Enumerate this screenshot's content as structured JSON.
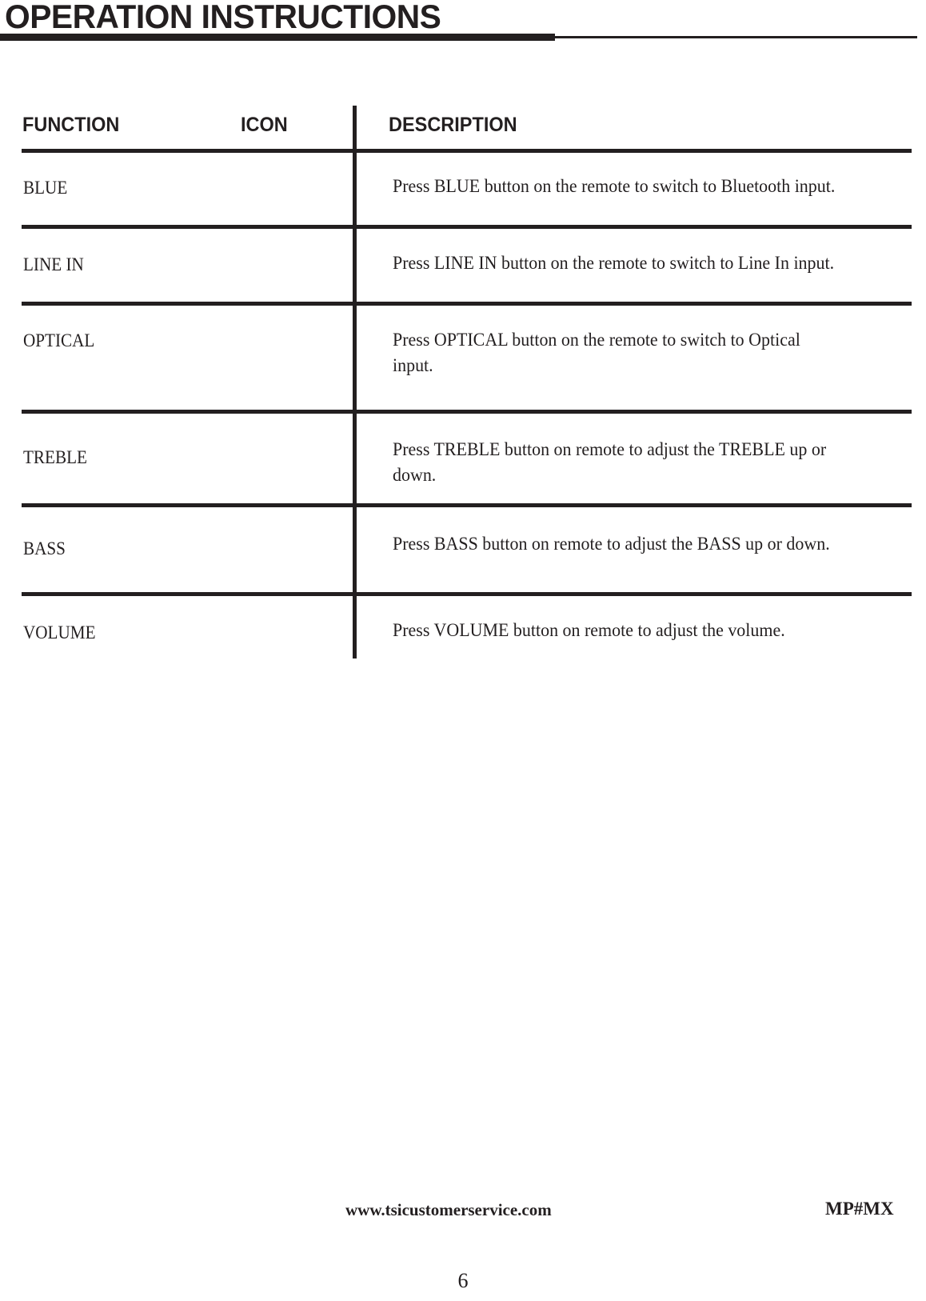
{
  "document": {
    "title": "OPERATION INSTRUCTIONS",
    "accent_color": "#231f20",
    "background_color": "#ffffff"
  },
  "table": {
    "headers": {
      "function": "FUNCTION",
      "icon": "ICON",
      "description": "DESCRIPTION"
    },
    "rows": [
      {
        "function": "BLUE",
        "icon": "",
        "description": "Press BLUE button on the remote to switch to Bluetooth input."
      },
      {
        "function": "LINE IN",
        "icon": "",
        "description": "Press LINE IN button on the remote to switch to Line In input."
      },
      {
        "function": "OPTICAL",
        "icon": "",
        "description": "Press OPTICAL button on the remote to switch to Optical input."
      },
      {
        "function": "TREBLE",
        "icon": "",
        "description": "Press TREBLE button on remote to adjust the TREBLE up or down."
      },
      {
        "function": "BASS",
        "icon": "",
        "description": "Press BASS button on remote to adjust the BASS up or down."
      },
      {
        "function": "VOLUME",
        "icon": "",
        "description": "Press VOLUME button on remote to adjust the volume."
      }
    ]
  },
  "footer": {
    "website": "www.tsicustomerservice.com",
    "model": "MP#MX",
    "page_number": "6"
  }
}
